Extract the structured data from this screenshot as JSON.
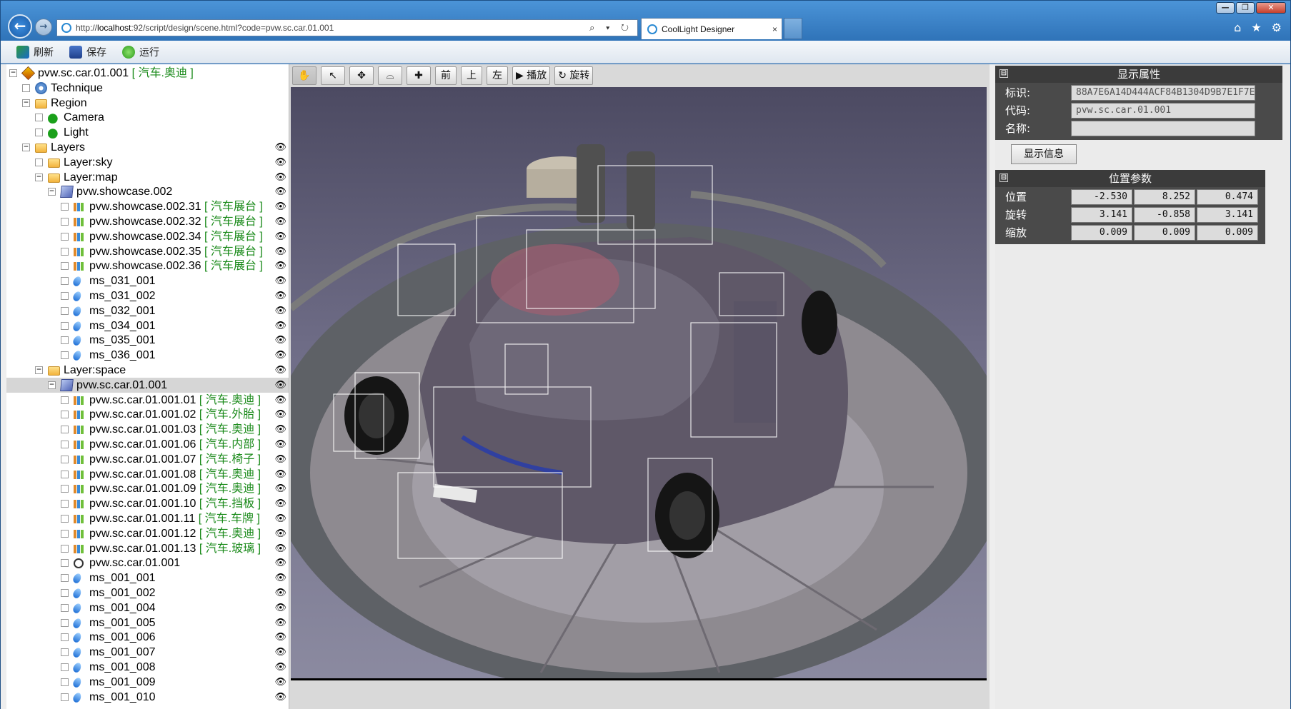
{
  "browser": {
    "url_prefix": "http://",
    "url_host": "localhost",
    "url_rest": ":92/script/design/scene.html?code=pvw.sc.car.01.001",
    "url_tools": "⌕ ▾ ↻",
    "tab_title": "CoolLight Designer",
    "tab_close": "×",
    "win_min": "—",
    "win_max": "❐",
    "win_close": "✕",
    "home_icon": "⌂",
    "star_icon": "★",
    "gear_icon": "⚙",
    "back_glyph": "←",
    "fwd_glyph": "→"
  },
  "cmdbar": {
    "refresh": "刷新",
    "save": "保存",
    "run": "运行"
  },
  "tree": {
    "eye": "👁",
    "rows": [
      {
        "name": "pvw.sc.car.01.001",
        "tag": "[ 汽车.奥迪 ]",
        "icon": "car",
        "indent": 0,
        "toggle": "−",
        "eye": false
      },
      {
        "name": "Technique",
        "tag": "",
        "icon": "gear",
        "indent": 1,
        "toggle": "□",
        "eye": false
      },
      {
        "name": "Region",
        "tag": "",
        "icon": "folder",
        "indent": 1,
        "toggle": "−",
        "eye": false
      },
      {
        "name": "Camera",
        "tag": "",
        "icon": "leaf",
        "indent": 2,
        "toggle": "□",
        "eye": false
      },
      {
        "name": "Light",
        "tag": "",
        "icon": "leaf",
        "indent": 2,
        "toggle": "□",
        "eye": false
      },
      {
        "name": "Layers",
        "tag": "",
        "icon": "folder",
        "indent": 1,
        "toggle": "−",
        "eye": true
      },
      {
        "name": "Layer:sky",
        "tag": "",
        "icon": "folder",
        "indent": 2,
        "toggle": "□",
        "eye": true
      },
      {
        "name": "Layer:map",
        "tag": "",
        "icon": "folder",
        "indent": 2,
        "toggle": "−",
        "eye": true
      },
      {
        "name": "pvw.showcase.002",
        "tag": "",
        "icon": "cube",
        "indent": 3,
        "toggle": "−",
        "eye": true
      },
      {
        "name": "pvw.showcase.002.31",
        "tag": "[ 汽车展台 ]",
        "icon": "mesh",
        "indent": 4,
        "toggle": "□",
        "eye": true
      },
      {
        "name": "pvw.showcase.002.32",
        "tag": "[ 汽车展台 ]",
        "icon": "mesh",
        "indent": 4,
        "toggle": "□",
        "eye": true
      },
      {
        "name": "pvw.showcase.002.34",
        "tag": "[ 汽车展台 ]",
        "icon": "mesh",
        "indent": 4,
        "toggle": "□",
        "eye": true
      },
      {
        "name": "pvw.showcase.002.35",
        "tag": "[ 汽车展台 ]",
        "icon": "mesh",
        "indent": 4,
        "toggle": "□",
        "eye": true
      },
      {
        "name": "pvw.showcase.002.36",
        "tag": "[ 汽车展台 ]",
        "icon": "mesh",
        "indent": 4,
        "toggle": "□",
        "eye": true
      },
      {
        "name": "ms_031_001",
        "tag": "",
        "icon": "drop",
        "indent": 4,
        "toggle": "□",
        "eye": true
      },
      {
        "name": "ms_031_002",
        "tag": "",
        "icon": "drop",
        "indent": 4,
        "toggle": "□",
        "eye": true
      },
      {
        "name": "ms_032_001",
        "tag": "",
        "icon": "drop",
        "indent": 4,
        "toggle": "□",
        "eye": true
      },
      {
        "name": "ms_034_001",
        "tag": "",
        "icon": "drop",
        "indent": 4,
        "toggle": "□",
        "eye": true
      },
      {
        "name": "ms_035_001",
        "tag": "",
        "icon": "drop",
        "indent": 4,
        "toggle": "□",
        "eye": true
      },
      {
        "name": "ms_036_001",
        "tag": "",
        "icon": "drop",
        "indent": 4,
        "toggle": "□",
        "eye": true
      },
      {
        "name": "Layer:space",
        "tag": "",
        "icon": "folder",
        "indent": 2,
        "toggle": "−",
        "eye": true
      },
      {
        "name": "pvw.sc.car.01.001",
        "tag": "",
        "icon": "cube",
        "indent": 3,
        "toggle": "−",
        "eye": true,
        "selected": true
      },
      {
        "name": "pvw.sc.car.01.001.01",
        "tag": "[ 汽车.奥迪 ]",
        "icon": "mesh",
        "indent": 4,
        "toggle": "□",
        "eye": true
      },
      {
        "name": "pvw.sc.car.01.001.02",
        "tag": "[ 汽车.外胎 ]",
        "icon": "mesh",
        "indent": 4,
        "toggle": "□",
        "eye": true
      },
      {
        "name": "pvw.sc.car.01.001.03",
        "tag": "[ 汽车.奥迪 ]",
        "icon": "mesh",
        "indent": 4,
        "toggle": "□",
        "eye": true
      },
      {
        "name": "pvw.sc.car.01.001.06",
        "tag": "[ 汽车.内部 ]",
        "icon": "mesh",
        "indent": 4,
        "toggle": "□",
        "eye": true
      },
      {
        "name": "pvw.sc.car.01.001.07",
        "tag": "[ 汽车.椅子 ]",
        "icon": "mesh",
        "indent": 4,
        "toggle": "□",
        "eye": true
      },
      {
        "name": "pvw.sc.car.01.001.08",
        "tag": "[ 汽车.奥迪 ]",
        "icon": "mesh",
        "indent": 4,
        "toggle": "□",
        "eye": true
      },
      {
        "name": "pvw.sc.car.01.001.09",
        "tag": "[ 汽车.奥迪 ]",
        "icon": "mesh",
        "indent": 4,
        "toggle": "□",
        "eye": true
      },
      {
        "name": "pvw.sc.car.01.001.10",
        "tag": "[ 汽车.挡板 ]",
        "icon": "mesh",
        "indent": 4,
        "toggle": "□",
        "eye": true
      },
      {
        "name": "pvw.sc.car.01.001.11",
        "tag": "[ 汽车.车牌 ]",
        "icon": "mesh",
        "indent": 4,
        "toggle": "□",
        "eye": true
      },
      {
        "name": "pvw.sc.car.01.001.12",
        "tag": "[ 汽车.奥迪 ]",
        "icon": "mesh",
        "indent": 4,
        "toggle": "□",
        "eye": true
      },
      {
        "name": "pvw.sc.car.01.001.13",
        "tag": "[ 汽车.玻璃 ]",
        "icon": "mesh",
        "indent": 4,
        "toggle": "□",
        "eye": true
      },
      {
        "name": "pvw.sc.car.01.001",
        "tag": "",
        "icon": "timer",
        "indent": 4,
        "toggle": "□",
        "eye": true
      },
      {
        "name": "ms_001_001",
        "tag": "",
        "icon": "drop",
        "indent": 4,
        "toggle": "□",
        "eye": true
      },
      {
        "name": "ms_001_002",
        "tag": "",
        "icon": "drop",
        "indent": 4,
        "toggle": "□",
        "eye": true
      },
      {
        "name": "ms_001_004",
        "tag": "",
        "icon": "drop",
        "indent": 4,
        "toggle": "□",
        "eye": true
      },
      {
        "name": "ms_001_005",
        "tag": "",
        "icon": "drop",
        "indent": 4,
        "toggle": "□",
        "eye": true
      },
      {
        "name": "ms_001_006",
        "tag": "",
        "icon": "drop",
        "indent": 4,
        "toggle": "□",
        "eye": true
      },
      {
        "name": "ms_001_007",
        "tag": "",
        "icon": "drop",
        "indent": 4,
        "toggle": "□",
        "eye": true
      },
      {
        "name": "ms_001_008",
        "tag": "",
        "icon": "drop",
        "indent": 4,
        "toggle": "□",
        "eye": true
      },
      {
        "name": "ms_001_009",
        "tag": "",
        "icon": "drop",
        "indent": 4,
        "toggle": "□",
        "eye": true
      },
      {
        "name": "ms_001_010",
        "tag": "",
        "icon": "drop",
        "indent": 4,
        "toggle": "□",
        "eye": true
      }
    ]
  },
  "viewport": {
    "tools": {
      "hand": "✋",
      "pointer": "↖",
      "move": "✥",
      "orbit": "⌓",
      "zoom": "✚",
      "front": "前",
      "top": "上",
      "left": "左",
      "play": "▶ 播放",
      "rotate": "↻ 旋转"
    }
  },
  "display_props": {
    "title": "显示属性",
    "toggle": "⊟",
    "id_label": "标识:",
    "id_value": "88A7E6A14D444ACF84B1304D9B7E1F7E",
    "code_label": "代码:",
    "code_value": "pvw.sc.car.01.001",
    "name_label": "名称:",
    "name_value": "",
    "info_tab": "显示信息"
  },
  "position_params": {
    "title": "位置参数",
    "toggle": "⊟",
    "rows": [
      {
        "label": "位置",
        "values": [
          "-2.530",
          "8.252",
          "0.474"
        ]
      },
      {
        "label": "旋转",
        "values": [
          "3.141",
          "-0.858",
          "3.141"
        ]
      },
      {
        "label": "缩放",
        "values": [
          "0.009",
          "0.009",
          "0.009"
        ]
      }
    ]
  },
  "colors": {
    "accent": "#3a7fc5",
    "tag_green": "#1a8a1a",
    "panel_dark": "#3b3b3b"
  }
}
